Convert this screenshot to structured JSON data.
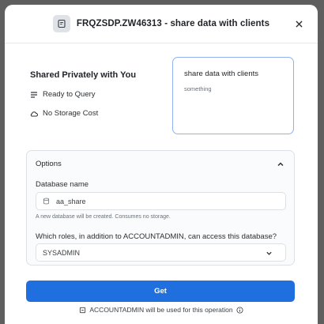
{
  "header": {
    "title": "FRQZSDP.ZW46313 - share data with clients",
    "db_icon": "database-icon",
    "close_icon": "close-icon"
  },
  "summary": {
    "heading": "Shared Privately with You",
    "features": [
      {
        "icon": "lines-icon",
        "label": "Ready to Query"
      },
      {
        "icon": "cloud-icon",
        "label": "No Storage Cost"
      }
    ]
  },
  "description_card": {
    "title": "share data with clients",
    "subtitle": "something"
  },
  "options": {
    "heading": "Options",
    "database_name_label": "Database name",
    "database_name_value": "aa_share",
    "database_hint": "A new database will be created. Consumes no storage.",
    "roles_label": "Which roles, in addition to ACCOUNTADMIN, can access this database?",
    "roles_selected": "SYSADMIN"
  },
  "actions": {
    "get_label": "Get"
  },
  "footer": {
    "note": "ACCOUNTADMIN will be used for this operation"
  },
  "colors": {
    "primary": "#1f6fde",
    "card_border": "#8fb1f2",
    "backdrop": "#5f5f5f"
  }
}
